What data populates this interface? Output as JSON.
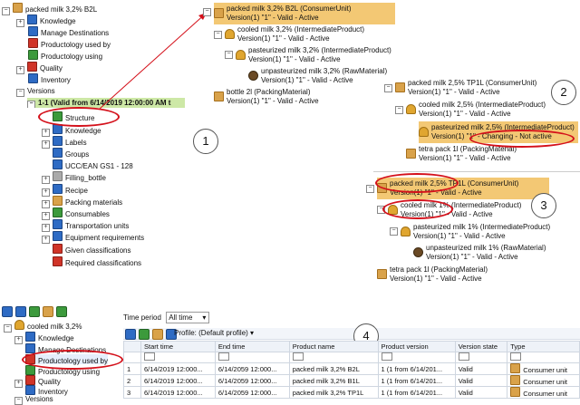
{
  "left_tree": {
    "root": "packed milk 3,2% B2L",
    "items": [
      "Knowledge",
      "Manage Destinations",
      "Productology used by",
      "Productology using",
      "Quality",
      "Inventory",
      "Versions"
    ],
    "version_row": "1-1 (Valid from 6/14/2019 12:00:00 AM t",
    "sub_items": [
      "Structure",
      "Knowledge",
      "Labels",
      "Groups",
      "UCC/EAN  GS1 - 128",
      "Filling_bottle",
      "Recipe",
      "Packing materials",
      "Consumables",
      "Transportation units",
      "Equipment requirements",
      "Given classifications",
      "Required classifications"
    ]
  },
  "panel1": {
    "root": {
      "name": "packed milk 3,2% B2L (ConsumerUnit)",
      "status": "Version(1) \"1\" - Valid - Active"
    },
    "n1": {
      "name": "cooled milk 3,2% (IntermediateProduct)",
      "status": "Version(1) \"1\" - Valid - Active"
    },
    "n2": {
      "name": "pasteurized milk 3,2% (IntermediateProduct)",
      "status": "Version(1) \"1\" - Valid - Active"
    },
    "n3": {
      "name": "unpasteurized milk 3,2% (RawMaterial)",
      "status": "Version(1) \"1\" - Valid - Active"
    },
    "n4": {
      "name": "bottle 2l (PackingMaterial)",
      "status": "Version(1) \"1\" - Valid - Active"
    }
  },
  "panel2": {
    "root": {
      "name": "packed milk 2,5% TP1L (ConsumerUnit)",
      "status": "Version(1) \"1\" - Valid - Active"
    },
    "n1": {
      "name": "cooled milk 2,5% (IntermediateProduct)",
      "status": "Version(1) \"1\" - Valid - Active"
    },
    "n2": {
      "name": "pasteurized milk 2,5% (IntermediateProduct)",
      "status": "Version(1) \"1\" - Changing - Not active"
    },
    "n3": {
      "name": "tetra pack 1l (PackingMaterial)",
      "status": "Version(1) \"1\" - Valid - Active"
    }
  },
  "panel3": {
    "root": {
      "name": "packed milk 2,5% TP1L (ConsumerUnit)",
      "status": "Version(1) \"1\" - Valid - Active"
    },
    "n1": {
      "name": "cooled milk 1% (IntermediateProduct)",
      "status": "Version(1) \"1\" - Valid - Active"
    },
    "n2": {
      "name": "pasteurized milk 1% (IntermediateProduct)",
      "status": "Version(1) \"1\" - Valid - Active"
    },
    "n3": {
      "name": "unpasteurized milk 1% (RawMaterial)",
      "status": "Version(1) \"1\" - Valid - Active"
    },
    "n4": {
      "name": "tetra pack 1l (PackingMaterial)",
      "status": "Version(1) \"1\" - Valid - Active"
    }
  },
  "callouts": [
    "1",
    "2",
    "3",
    "4"
  ],
  "bottom_tree": {
    "root": "cooled milk 3,2%",
    "items": [
      "Knowledge",
      "Manage Destinations",
      "Productology used by",
      "Productology using",
      "Quality",
      "Inventory",
      "Versions"
    ]
  },
  "time_period": {
    "label": "Time period",
    "value": "All time"
  },
  "toolbar": {
    "profile": "Profile: (Default profile)"
  },
  "table": {
    "columns": [
      "Start time",
      "End time",
      "Product name",
      "Product version",
      "Version state",
      "Type"
    ],
    "rows": [
      {
        "num": "1",
        "start": "6/14/2019 12:000...",
        "end": "6/14/2059 12:000...",
        "name": "packed milk 3,2% B2L",
        "version": "1 (1 from 6/14/201...",
        "state": "Valid",
        "type": "Consumer unit"
      },
      {
        "num": "2",
        "start": "6/14/2019 12:000...",
        "end": "6/14/2059 12:000...",
        "name": "packed milk 3,2% B1L",
        "version": "1 (1 from 6/14/201...",
        "state": "Valid",
        "type": "Consumer unit"
      },
      {
        "num": "3",
        "start": "6/14/2019 12:000...",
        "end": "6/14/2059 12:000...",
        "name": "packed milk 3,2% TP1L",
        "version": "1 (1 from 6/14/201...",
        "state": "Valid",
        "type": "Consumer unit"
      }
    ]
  },
  "colors": {
    "annotation_red": "#d4101a",
    "header_orange": "#f3c874",
    "selected_green": "#cde8a6"
  }
}
